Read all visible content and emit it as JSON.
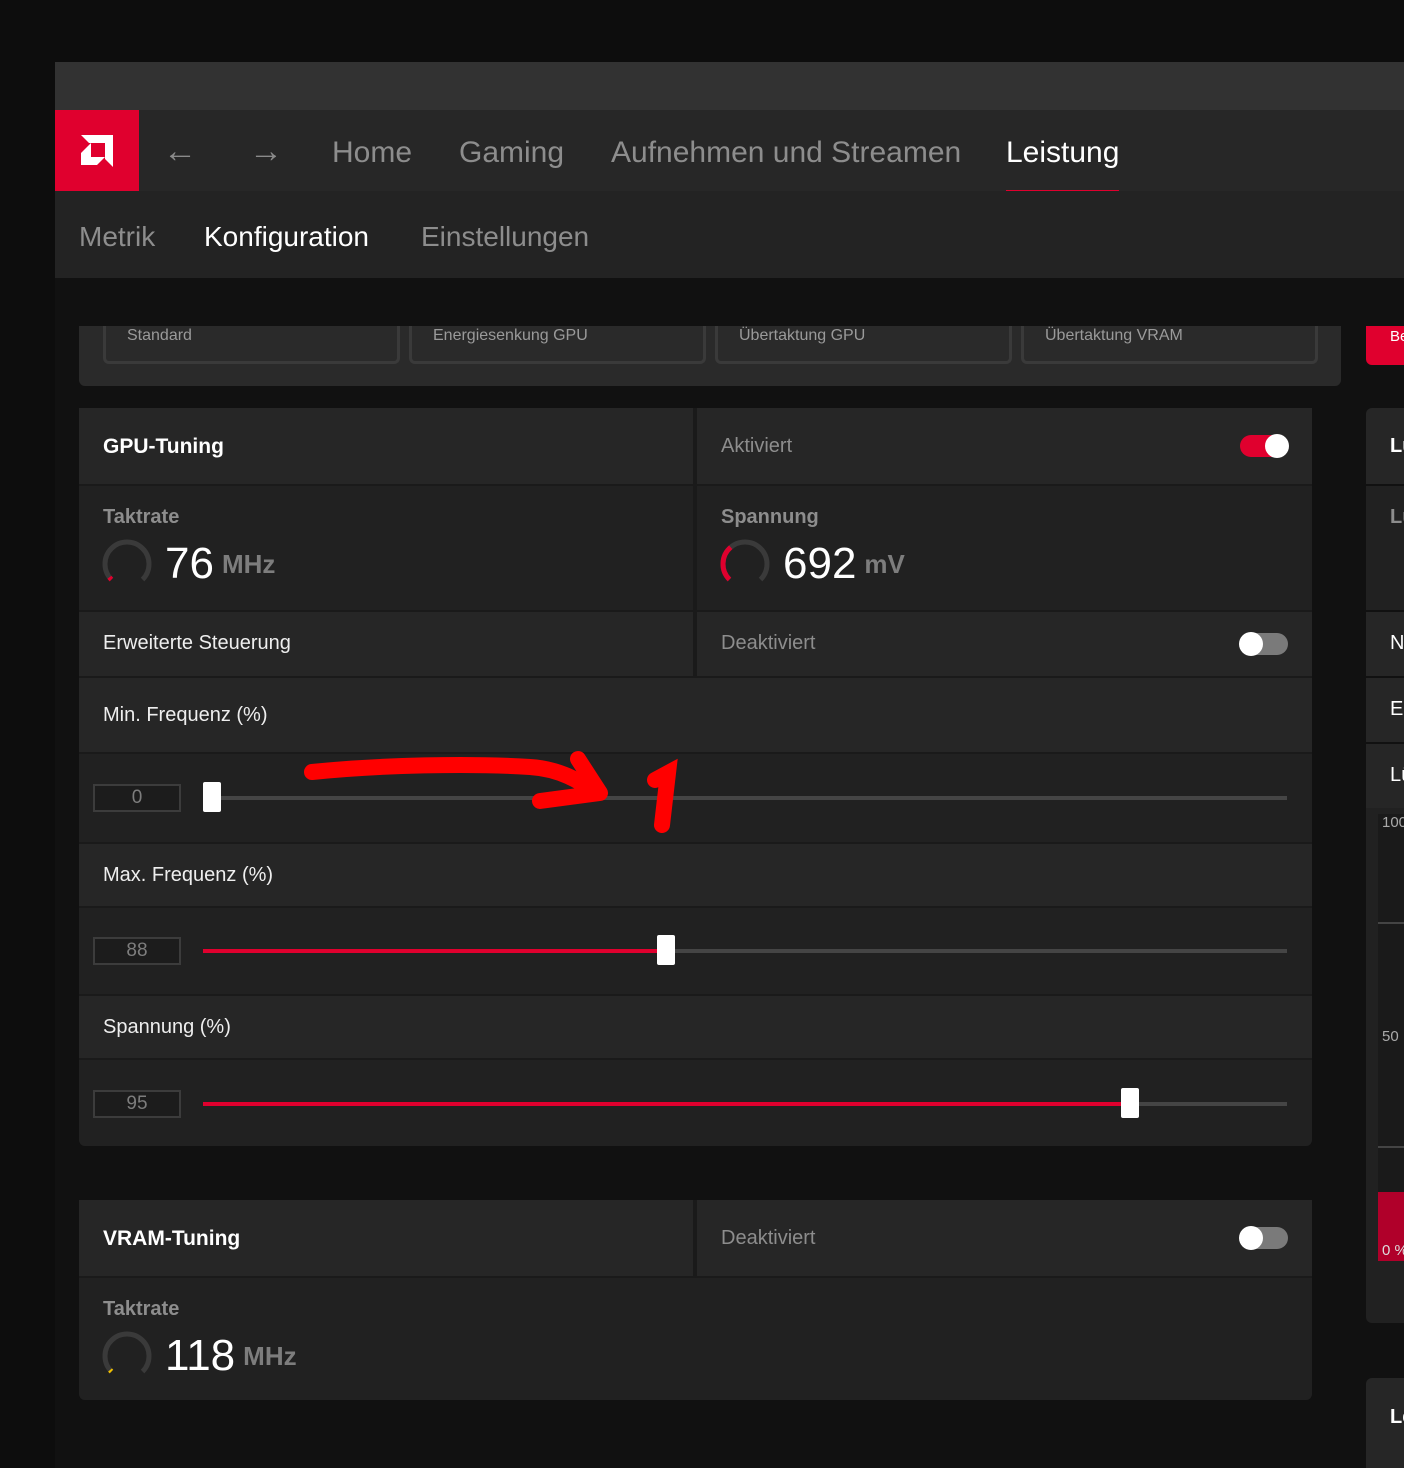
{
  "colors": {
    "accent": "#e0002e",
    "background": "#111111",
    "panel": "#262626"
  },
  "nav": {
    "back_icon": "arrow-left-icon",
    "forward_icon": "arrow-right-icon",
    "items": [
      {
        "label": "Home",
        "active": false
      },
      {
        "label": "Gaming",
        "active": false
      },
      {
        "label": "Aufnehmen und Streamen",
        "active": false
      },
      {
        "label": "Leistung",
        "active": true
      }
    ]
  },
  "subnav": {
    "items": [
      {
        "label": "Metrik",
        "active": false
      },
      {
        "label": "Konfiguration",
        "active": true
      },
      {
        "label": "Einstellungen",
        "active": false
      }
    ]
  },
  "presets": [
    "Standard",
    "Energiesenkung GPU",
    "Übertaktung GPU",
    "Übertaktung VRAM",
    "Be"
  ],
  "gpu_tuning": {
    "title": "GPU-Tuning",
    "state": "Aktiviert",
    "enabled": true,
    "clock": {
      "label": "Taktrate",
      "value": "76",
      "unit": "MHz",
      "gauge_fraction": 0.03
    },
    "voltage": {
      "label": "Spannung",
      "value": "692",
      "unit": "mV",
      "gauge_fraction": 0.35
    },
    "advanced": {
      "label": "Erweiterte Steuerung",
      "state": "Deaktiviert",
      "enabled": false
    },
    "sliders": [
      {
        "label": "Min. Frequenz (%)",
        "value": "0",
        "fill": 0.008
      },
      {
        "label": "Max. Frequenz (%)",
        "value": "88",
        "fill": 0.427
      },
      {
        "label": "Spannung (%)",
        "value": "95",
        "fill": 0.855
      }
    ]
  },
  "vram_tuning": {
    "title": "VRAM-Tuning",
    "state": "Deaktiviert",
    "enabled": false,
    "clock": {
      "label": "Taktrate",
      "value": "118",
      "unit": "MHz",
      "gauge_fraction": 0.02
    }
  },
  "right_panel": {
    "rows": [
      "Lü",
      "Lü",
      "N",
      "Er",
      "Lü"
    ],
    "chart_ticks": [
      "100",
      "50",
      "0 %"
    ],
    "footer": "Le"
  }
}
